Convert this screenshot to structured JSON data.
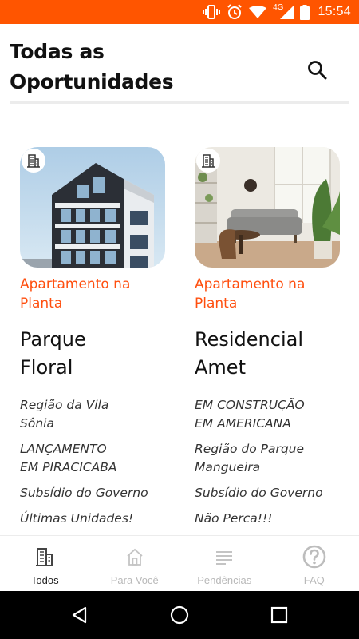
{
  "status_bar": {
    "network": "4G",
    "time": "15:54",
    "icons": [
      "vibrate-icon",
      "alarm-icon",
      "wifi-icon",
      "signal-icon",
      "battery-icon"
    ]
  },
  "header": {
    "title_line1": "Todas as",
    "title_line2": "Oportunidades",
    "search_icon": "search-icon"
  },
  "cards": [
    {
      "badge_icon": "building-icon",
      "image": "modern-apartment-building-photo",
      "category_line1": "Apartamento na",
      "category_line2": "Planta",
      "name_line1": "Parque",
      "name_line2": "Floral",
      "tags": [
        {
          "line1": "Região da Vila",
          "line2": "Sônia"
        },
        {
          "line1": "LANÇAMENTO",
          "line2": "EM PIRACICABA"
        },
        {
          "line1": "Subsídio do Governo",
          "line2": ""
        },
        {
          "line1": "Últimas Unidades!",
          "line2": ""
        }
      ]
    },
    {
      "badge_icon": "building-icon",
      "image": "living-room-interior-photo",
      "category_line1": "Apartamento na",
      "category_line2": "Planta",
      "name_line1": "Residencial",
      "name_line2": "Amet",
      "tags": [
        {
          "line1": "EM CONSTRUÇÃO",
          "line2": "EM AMERICANA"
        },
        {
          "line1": "Região do Parque",
          "line2": "Mangueira"
        },
        {
          "line1": "Subsídio do Governo",
          "line2": ""
        },
        {
          "line1": "Não Perca!!!",
          "line2": ""
        }
      ]
    }
  ],
  "bottom_nav": {
    "items": [
      {
        "label": "Todos",
        "icon": "building-icon",
        "active": true
      },
      {
        "label": "Para Você",
        "icon": "home-icon",
        "active": false
      },
      {
        "label": "Pendências",
        "icon": "list-icon",
        "active": false
      },
      {
        "label": "FAQ",
        "icon": "help-icon",
        "active": false
      }
    ]
  },
  "colors": {
    "accent": "#ff5500",
    "category_text": "#ff4f0f",
    "inactive_nav": "#b9b9b9"
  }
}
